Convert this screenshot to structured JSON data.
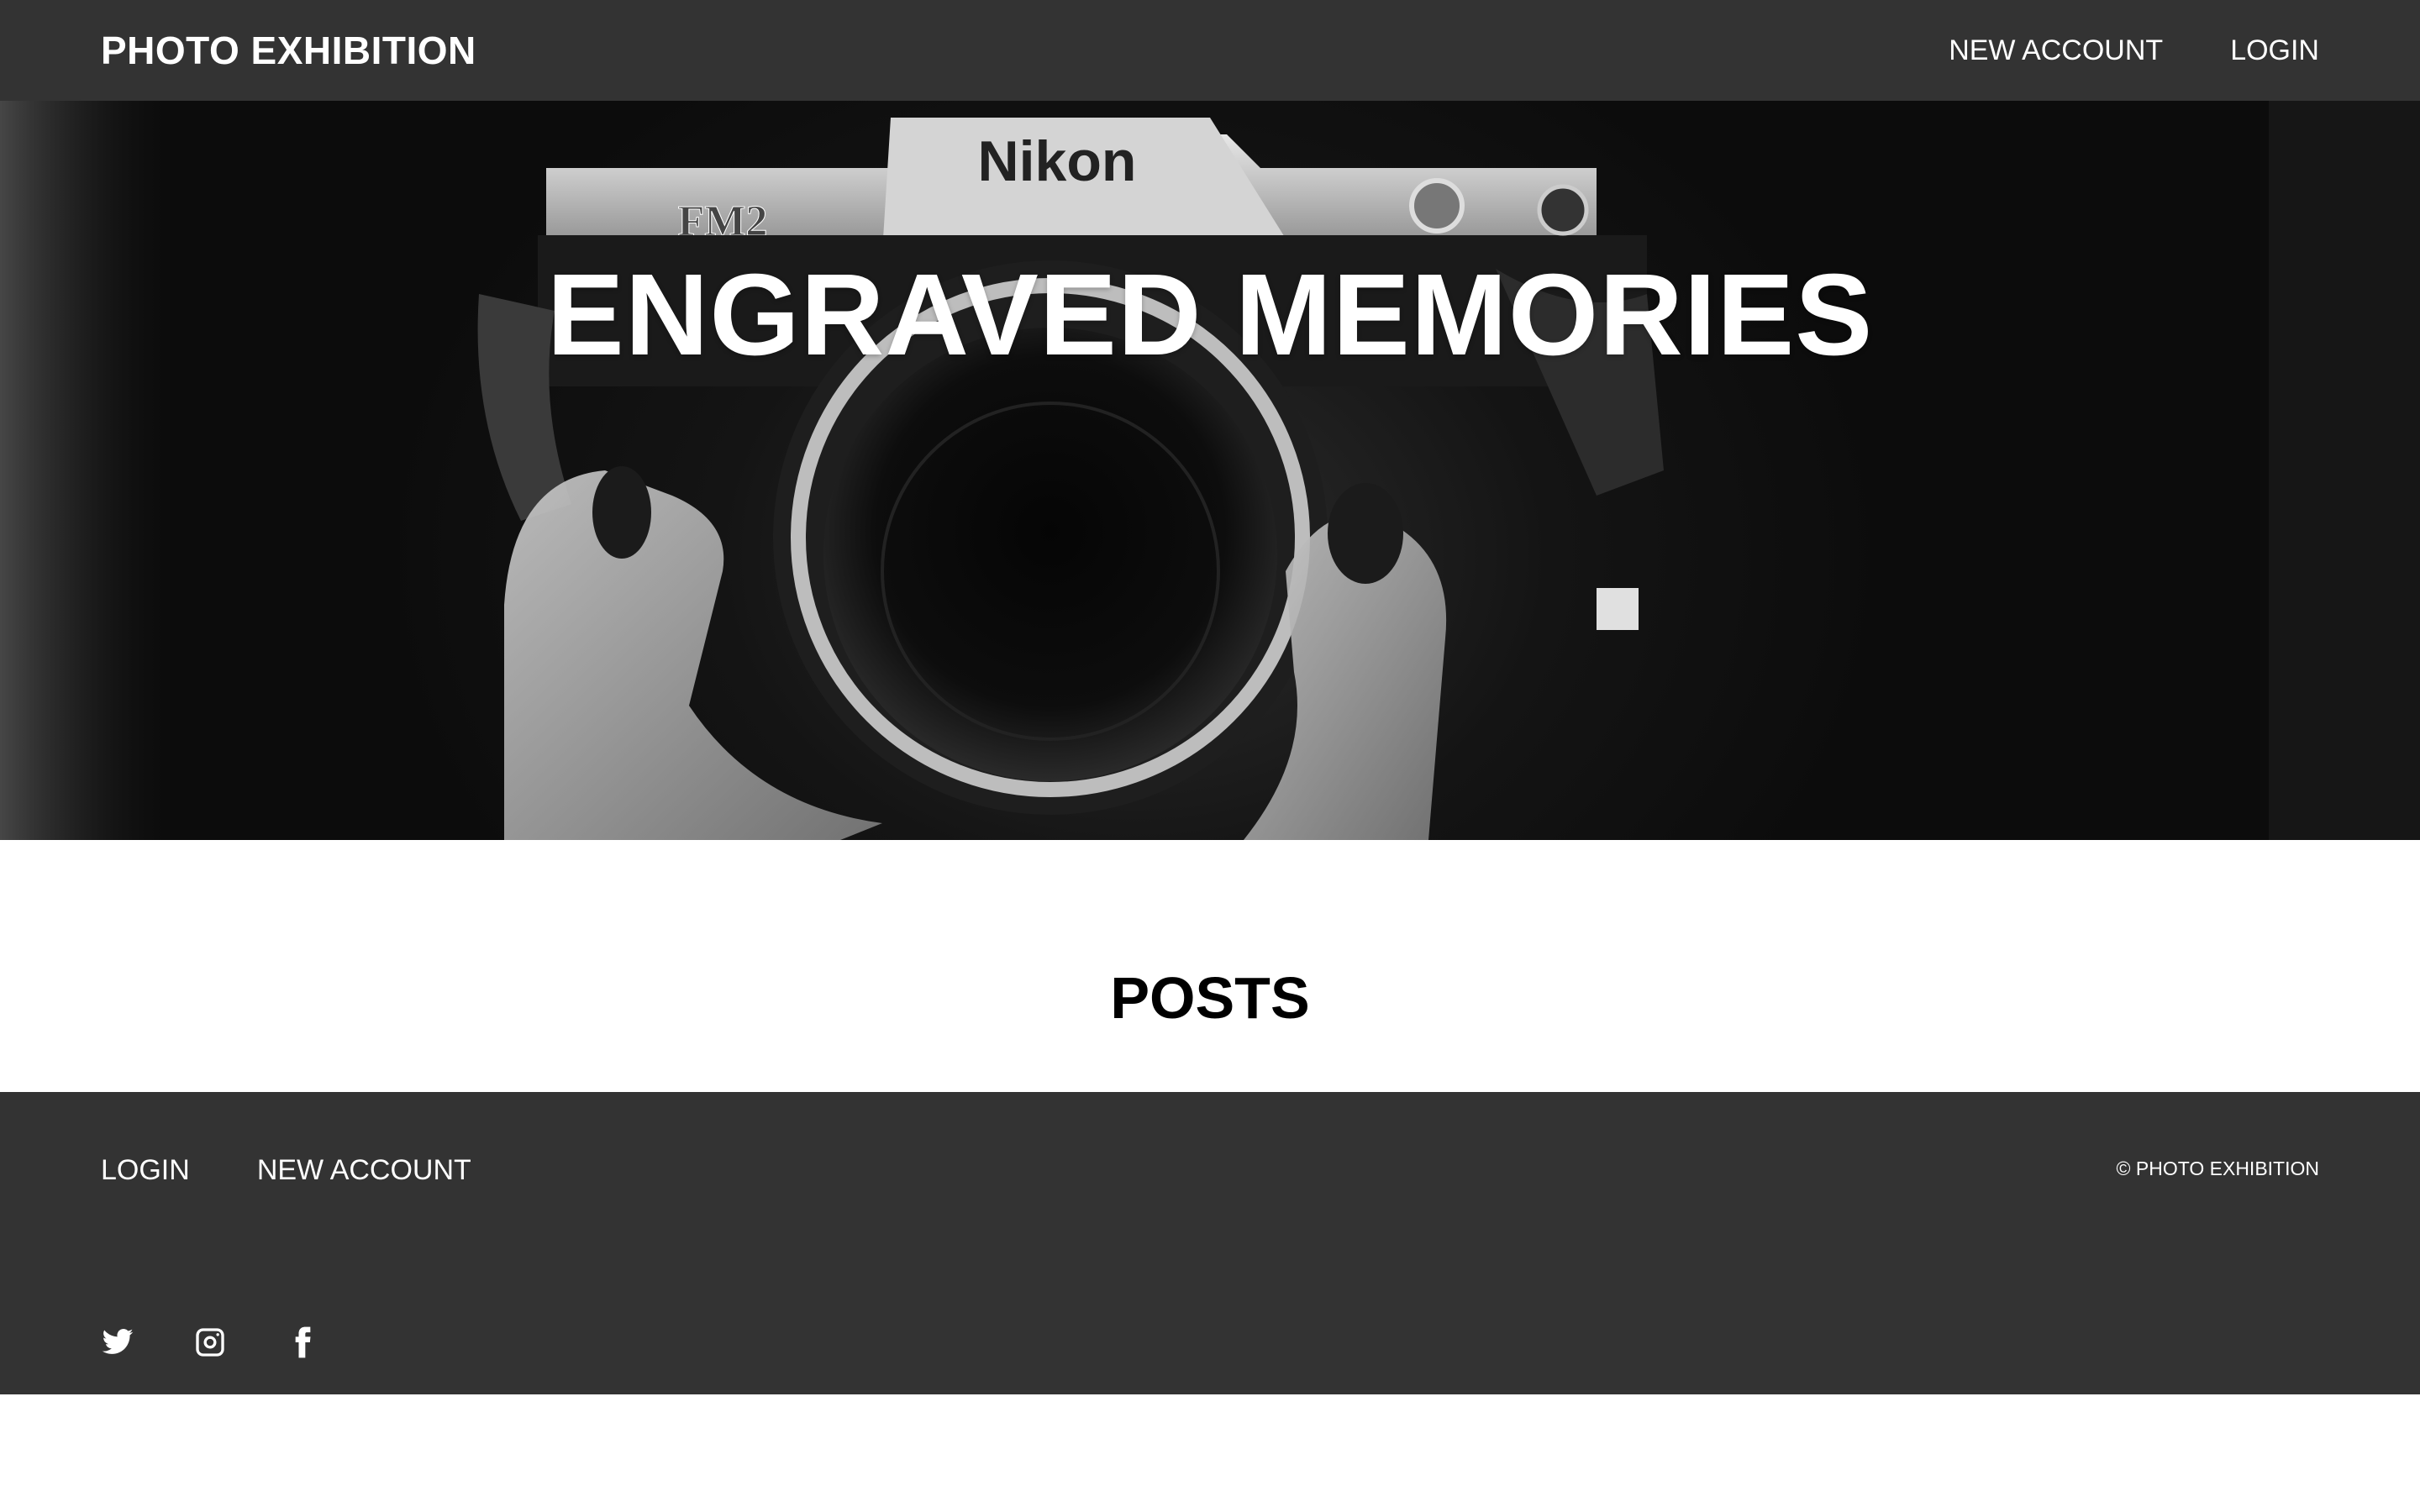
{
  "header": {
    "brand": "PHOTO EXHIBITION",
    "nav": [
      {
        "label": "NEW ACCOUNT"
      },
      {
        "label": "LOGIN"
      }
    ]
  },
  "hero": {
    "title": "ENGRAVED MEMORIES",
    "image": {
      "camera_brand": "Nikon",
      "camera_model": "FM2"
    }
  },
  "posts": {
    "heading": "POSTS"
  },
  "footer": {
    "nav": [
      {
        "label": "LOGIN"
      },
      {
        "label": "NEW ACCOUNT"
      }
    ],
    "copyright": "© PHOTO EXHIBITION",
    "social": [
      {
        "icon": "twitter-icon"
      },
      {
        "icon": "instagram-icon"
      },
      {
        "icon": "facebook-icon"
      }
    ]
  },
  "colors": {
    "header_bg": "#333333",
    "footer_bg": "#333333",
    "text_light": "#ffffff",
    "text_dark": "#000000"
  }
}
